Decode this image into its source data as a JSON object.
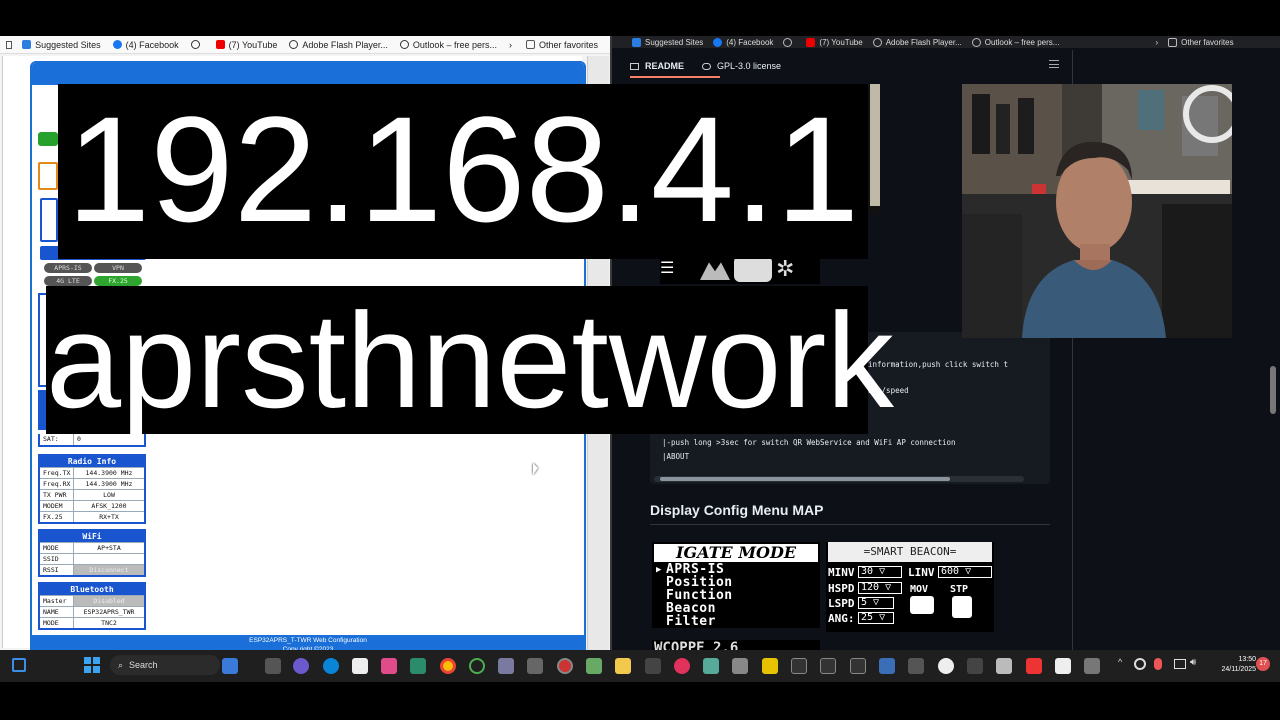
{
  "left_browser": {
    "favorites": [
      "Suggested Sites",
      "(4) Facebook",
      "(7) YouTube",
      "Adobe Flash Player...",
      "Outlook – free pers...",
      "Other favorites"
    ],
    "config": {
      "footer_line": "ESP32APRS_T-TWR Web Configuration",
      "footer_copy": "Copy right ©2023",
      "status": {
        "aprs_is": "APRS-IS",
        "vpn": "VPN",
        "lte": "4G LTE",
        "fx25": "FX.25"
      },
      "sat_label": "SAT:",
      "sat_value": "0",
      "radio": {
        "title": "Radio Info",
        "rows": [
          {
            "k": "Freq.TX",
            "v": "144.3900 MHz"
          },
          {
            "k": "Freq.RX",
            "v": "144.3900 MHz"
          },
          {
            "k": "TX PWR",
            "v": "LOW"
          },
          {
            "k": "MODEM",
            "v": "AFSK_1200"
          },
          {
            "k": "FX.25",
            "v": "RX+TX"
          }
        ]
      },
      "wifi": {
        "title": "WiFi",
        "rows": [
          {
            "k": "MODE",
            "v": "AP+STA"
          },
          {
            "k": "SSID",
            "v": ""
          },
          {
            "k": "RSSI",
            "v": "Disconnect"
          }
        ]
      },
      "bluetooth": {
        "title": "Bluetooth",
        "rows": [
          {
            "k": "Master",
            "v": "Disabled"
          },
          {
            "k": "NAME",
            "v": "ESP32APRS_TWR"
          },
          {
            "k": "MODE",
            "v": "TNC2"
          }
        ]
      }
    }
  },
  "right_browser": {
    "favorites": [
      "Suggested Sites",
      "(4) Facebook",
      "(7) YouTube",
      "Adobe Flash Player...",
      "Outlook – free pers...",
      "Other favorites"
    ],
    "tabs": [
      "README",
      "GPL-3.0 license"
    ],
    "code_lines": [
      "information,push click switch t",
      "ass/speed",
      "|-push long >3sec for switch QR WebService and WiFi AP connection",
      "|ABOUT"
    ],
    "section_title": "Display Config Menu MAP",
    "lcd_left": {
      "banner": "IGATE MODE",
      "items": [
        "APRS-IS",
        "Position",
        "Function",
        "Beacon",
        "Filter"
      ]
    },
    "lcd_right": {
      "banner": "=SMART BEACON=",
      "rows": [
        {
          "k": "MINV",
          "v": "30",
          "k2": "LINV",
          "v2": "600"
        },
        {
          "k": "HSPD",
          "v": "120"
        },
        {
          "k": "LSPD",
          "v": "5"
        },
        {
          "k": "ANG",
          "v": "25"
        }
      ],
      "mov": "MOV",
      "stp": "STP"
    },
    "lcd_partial": "WCOPPE 2.6"
  },
  "overlay": {
    "ip": "192.168.4.1",
    "network": "aprsthnetwork"
  },
  "taskbar": {
    "search": "Search",
    "time": "13:50",
    "date": "24/11/2025",
    "notif": "17"
  }
}
